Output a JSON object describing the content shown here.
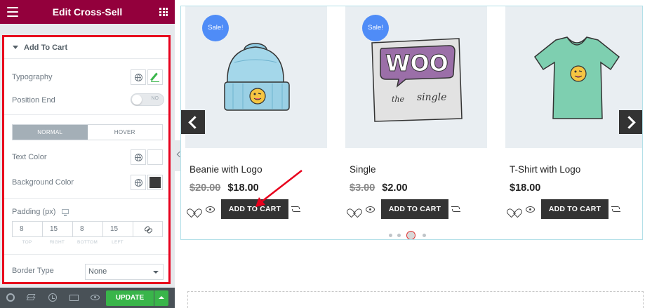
{
  "panel": {
    "title": "Edit Cross-Sell",
    "section_title": "Add To Cart",
    "typography_label": "Typography",
    "position_end_label": "Position End",
    "position_end_toggle": "NO",
    "tabs": [
      "NORMAL",
      "HOVER"
    ],
    "text_color_label": "Text Color",
    "background_color_label": "Background Color",
    "background_color_value": "#3a3a3a",
    "padding_label": "Padding (px)",
    "padding_values": [
      "8",
      "15",
      "8",
      "15"
    ],
    "padding_sides": [
      "TOP",
      "RIGHT",
      "BOTTOM",
      "LEFT"
    ],
    "border_type_label": "Border Type",
    "border_type_value": "None",
    "update_label": "UPDATE",
    "colors": {
      "header": "#93003c",
      "update": "#39b54a",
      "highlight": "#e8001c"
    }
  },
  "preview": {
    "products": [
      {
        "name": "Beanie with Logo",
        "old_price": "$20.00",
        "price": "$18.00",
        "sale_badge": "Sale!",
        "button": "ADD TO CART"
      },
      {
        "name": "Single",
        "old_price": "$3.00",
        "price": "$2.00",
        "sale_badge": "Sale!",
        "button": "ADD TO CART"
      },
      {
        "name": "T-Shirt with Logo",
        "old_price": "",
        "price": "$18.00",
        "sale_badge": "",
        "button": "ADD TO CART"
      }
    ],
    "carousel": {
      "dot_count": 4,
      "active_dot": 3
    }
  }
}
